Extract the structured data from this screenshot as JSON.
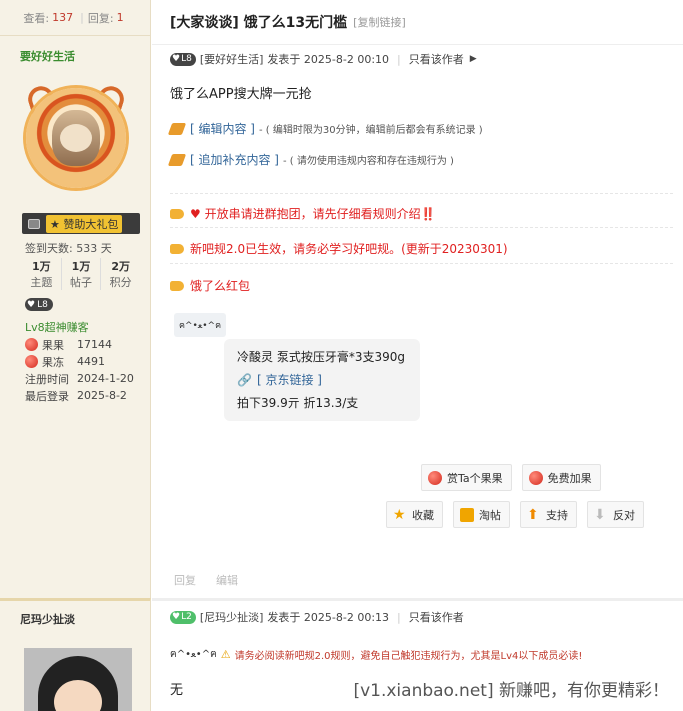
{
  "thread": {
    "views_label": "查看:",
    "views": "137",
    "replies_label": "回复:",
    "replies": "1",
    "title": "[大家谈谈] 饿了么13无门槛",
    "copy_link": "[复制链接]"
  },
  "author1": {
    "name": "要好好生活",
    "gift_label": "赞助大礼包",
    "sign_days": "签到天数: 533 天",
    "stats": [
      {
        "value": "1万",
        "label": "主题"
      },
      {
        "value": "1万",
        "label": "帖子"
      },
      {
        "value": "2万",
        "label": "积分"
      }
    ],
    "level_badge": "L8",
    "level_title": "Lv8超神赚客",
    "apples_label": "果果",
    "apples": "17144",
    "frozen_label": "果冻",
    "frozen": "4491",
    "reg_label": "注册时间",
    "reg_date": "2024-1-20",
    "last_label": "最后登录",
    "last_date": "2025-8-2"
  },
  "post1": {
    "level": "L8",
    "author_tag": "[要好好生活]",
    "posted": "发表于 2025-8-2 00:10",
    "only_author": "只看该作者",
    "text": "饿了么APP搜大牌一元抢",
    "edit_label": "[ 编辑内容 ]",
    "edit_note": "- ( 编辑时限为30分钟，编辑前后都会有系统记录 )",
    "add_label": "[ 追加补充内容 ]",
    "add_note": "- ( 请勿使用违规内容和存在违规行为 )",
    "notice1": "♥ 开放串请进群抱团，请先仔细看规则介绍‼️",
    "notice2": "新吧规2.0已生效，请务必学习好吧规。(更新于20230301)",
    "notice3": "饿了么红包",
    "emoticon": "ฅ^•ﻌ•^ฅ",
    "card_line1": "冷酸灵 泵式按压牙膏*3支390g",
    "card_link": "[ 京东链接 ]",
    "card_line3": "拍下39.9亓 折13.3/支",
    "btn_reward": "赏Ta个果果",
    "btn_free": "免费加果",
    "btn_fav": "收藏",
    "btn_share": "淘帖",
    "btn_support": "支持",
    "btn_oppose": "反对",
    "reply": "回复",
    "edit": "编辑"
  },
  "author2": {
    "name": "尼玛少扯淡"
  },
  "post2": {
    "level": "L2",
    "author_tag": "[尼玛少扯淡]",
    "posted": "发表于 2025-8-2 00:13",
    "only_author": "只看该作者",
    "emoticon": "ฅ^•ﻌ•^ฅ",
    "warning": "请务必阅读新吧规2.0规则，避免自己触犯违规行为，尤其是Lv4以下成员必读!",
    "text": "无"
  },
  "watermark": "[v1.xianbao.net] 新赚吧，有你更精彩！"
}
